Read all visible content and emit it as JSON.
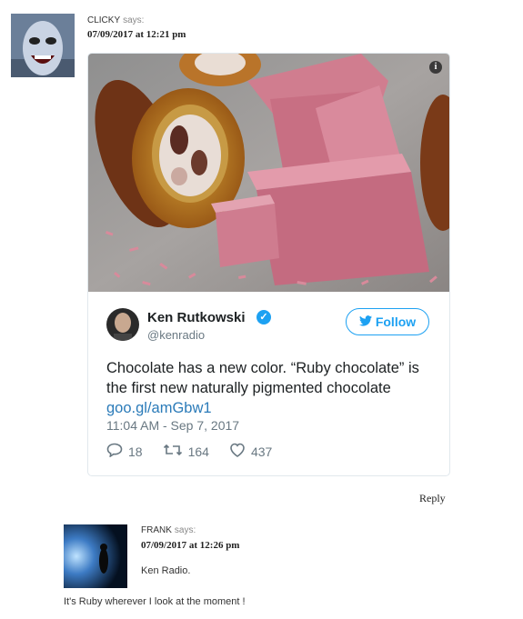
{
  "comment1": {
    "author": "CLICKY",
    "says": "says:",
    "date": "07/09/2017 at 12:21 pm"
  },
  "tweet": {
    "info_icon": "i",
    "author_name": "Ken Rutkowski",
    "handle": "@kenradio",
    "follow_label": "Follow",
    "text": "Chocolate has a new color. “Ruby chocolate” is the first new naturally pigmented chocolate",
    "link": "goo.gl/amGbw1",
    "timestamp": "11:04 AM - Sep 7, 2017",
    "replies": "18",
    "retweets": "164",
    "likes": "437",
    "accent_color": "#1da1f2"
  },
  "reply_label": "Reply",
  "comment2": {
    "author": "FRANK",
    "says": "says:",
    "date": "07/09/2017 at 12:26 pm",
    "line1": "Ken Radio.",
    "line2": "It's Ruby wherever I look at the moment !"
  }
}
